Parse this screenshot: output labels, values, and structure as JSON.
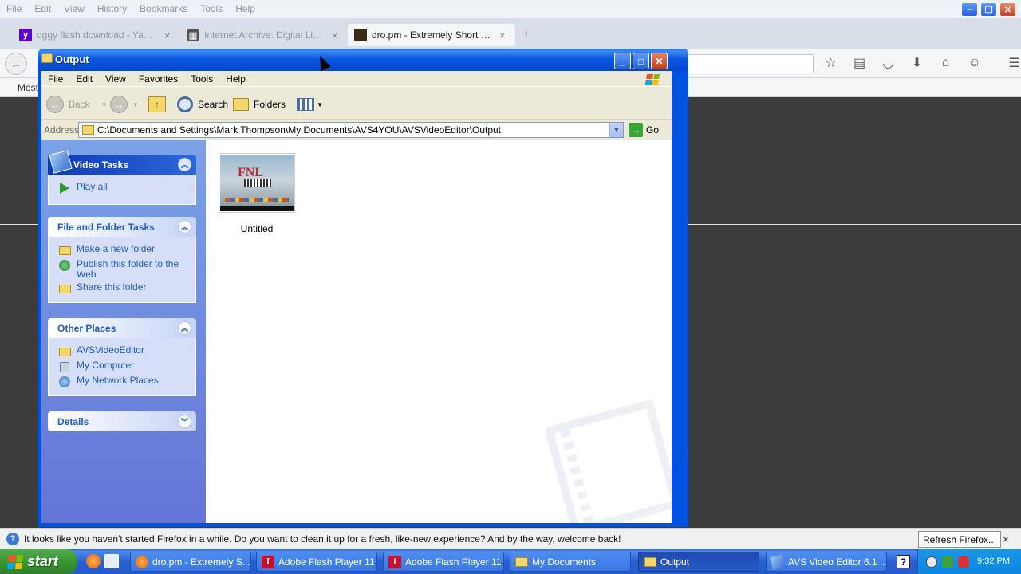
{
  "firefox": {
    "menu": [
      "File",
      "Edit",
      "View",
      "History",
      "Bookmarks",
      "Tools",
      "Help"
    ],
    "tabs": [
      {
        "label": "oggy flash download - Yahoo ...",
        "close": "×"
      },
      {
        "label": "Internet Archive: Digital Libra...",
        "close": "×"
      },
      {
        "label": "dro.pm - Extremely Short Links",
        "close": "×"
      }
    ],
    "new_tab": "+",
    "bookmarks_label": "Most"
  },
  "explorer": {
    "title": "Output",
    "menu": [
      "File",
      "Edit",
      "View",
      "Favorites",
      "Tools",
      "Help"
    ],
    "toolbar": {
      "back": "Back",
      "search": "Search",
      "folders": "Folders"
    },
    "address_label": "Address",
    "address_value": "C:\\Documents and Settings\\Mark Thompson\\My Documents\\AVS4YOU\\AVSVideoEditor\\Output",
    "go_label": "Go",
    "video_tasks": {
      "title": "Video Tasks",
      "items": [
        "Play all"
      ]
    },
    "file_folder_tasks": {
      "title": "File and Folder Tasks",
      "items": [
        "Make a new folder",
        "Publish this folder to the Web",
        "Share this folder"
      ]
    },
    "other_places": {
      "title": "Other Places",
      "items": [
        "AVSVideoEditor",
        "My Computer",
        "My Network Places"
      ]
    },
    "details": {
      "title": "Details"
    },
    "files": [
      {
        "name": "Untitled",
        "thumb_text": "FNL"
      }
    ]
  },
  "notification": {
    "text": "It looks like you haven't started Firefox in a while. Do you want to clean it up for a fresh, like-new experience? And by the way, welcome back!",
    "button": "Refresh Firefox...",
    "close": "×"
  },
  "taskbar": {
    "start": "start",
    "tasks": [
      {
        "label": "dro.pm - Extremely S..."
      },
      {
        "label": "Adobe Flash Player 11"
      },
      {
        "label": "Adobe Flash Player 11"
      },
      {
        "label": "My Documents"
      },
      {
        "label": "Output"
      },
      {
        "label": "AVS Video Editor 6.1 ..."
      }
    ],
    "clock": "9:32 PM"
  }
}
